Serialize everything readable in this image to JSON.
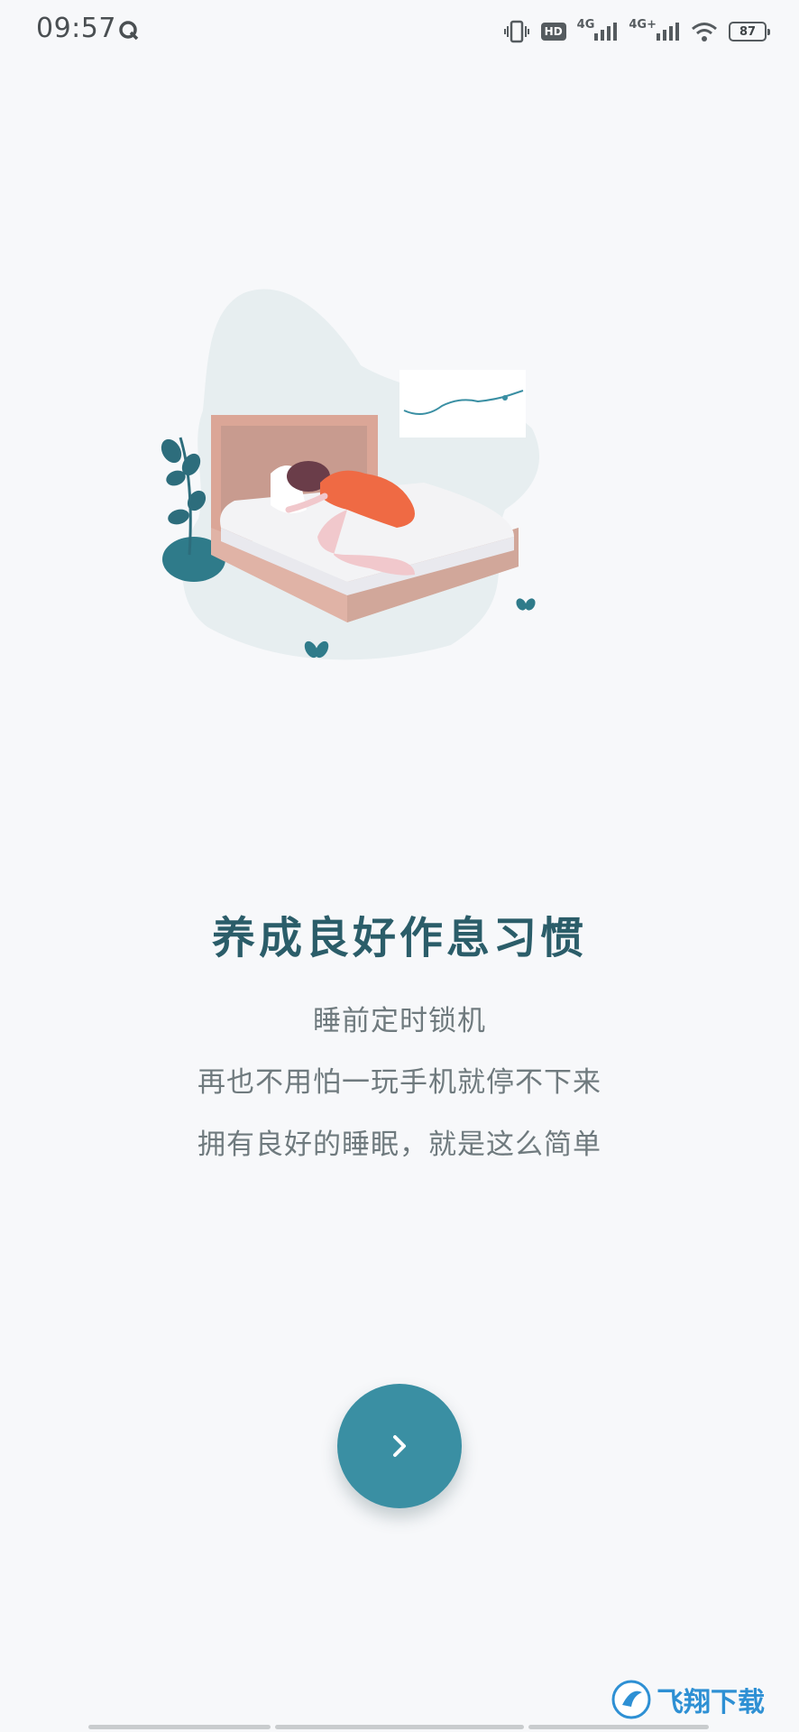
{
  "status_bar": {
    "time": "09:57",
    "hd_label": "HD",
    "net1_label": "4G",
    "net2_label": "4G+",
    "battery_level": "87"
  },
  "onboarding": {
    "headline": "养成良好作息习惯",
    "desc_line1": "睡前定时锁机",
    "desc_line2": "再也不用怕一玩手机就停不下来",
    "desc_line3": "拥有良好的睡眠，就是这么简单"
  },
  "next_button": {
    "icon": "chevron-right-icon"
  },
  "watermark": {
    "text": "飞翔下载"
  },
  "colors": {
    "background": "#f7f8fa",
    "headline": "#2b5d69",
    "accent": "#3a8fa3"
  }
}
